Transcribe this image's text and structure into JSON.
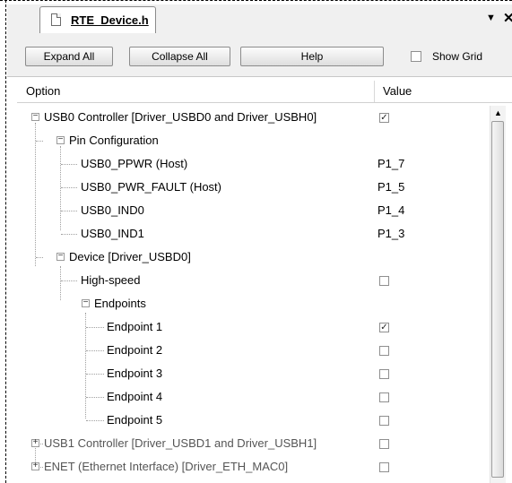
{
  "tab": {
    "title": "RTE_Device.h",
    "dropdown_icon": "▼",
    "close_icon": "✕"
  },
  "toolbar": {
    "expand_all": "Expand All",
    "collapse_all": "Collapse All",
    "help": "Help",
    "show_grid_label": "Show Grid",
    "show_grid_checked": false
  },
  "columns": {
    "option": "Option",
    "value": "Value"
  },
  "tree": {
    "usb0": {
      "label": "USB0 Controller [Driver_USBD0 and Driver_USBH0]",
      "checked": true,
      "expanded": true
    },
    "pin_config": {
      "label": "Pin Configuration"
    },
    "ppwr": {
      "label": "USB0_PPWR (Host)",
      "value": "P1_7"
    },
    "pwr_fault": {
      "label": "USB0_PWR_FAULT (Host)",
      "value": "P1_5"
    },
    "ind0": {
      "label": "USB0_IND0",
      "value": "P1_4"
    },
    "ind1": {
      "label": "USB0_IND1",
      "value": "P1_3"
    },
    "device": {
      "label": "Device [Driver_USBD0]"
    },
    "high_speed": {
      "label": "High-speed",
      "checked": false
    },
    "endpoints": {
      "label": "Endpoints"
    },
    "ep1": {
      "label": "Endpoint 1",
      "checked": true
    },
    "ep2": {
      "label": "Endpoint 2",
      "checked": false
    },
    "ep3": {
      "label": "Endpoint 3",
      "checked": false
    },
    "ep4": {
      "label": "Endpoint 4",
      "checked": false
    },
    "ep5": {
      "label": "Endpoint 5",
      "checked": false
    },
    "usb1": {
      "label": "USB1 Controller [Driver_USBD1 and Driver_USBH1]",
      "checked": false
    },
    "enet": {
      "label": "ENET (Ethernet Interface) [Driver_ETH_MAC0]",
      "checked": false
    }
  },
  "icons": {
    "expanded": "−",
    "collapsed": "+",
    "check": "✓"
  }
}
